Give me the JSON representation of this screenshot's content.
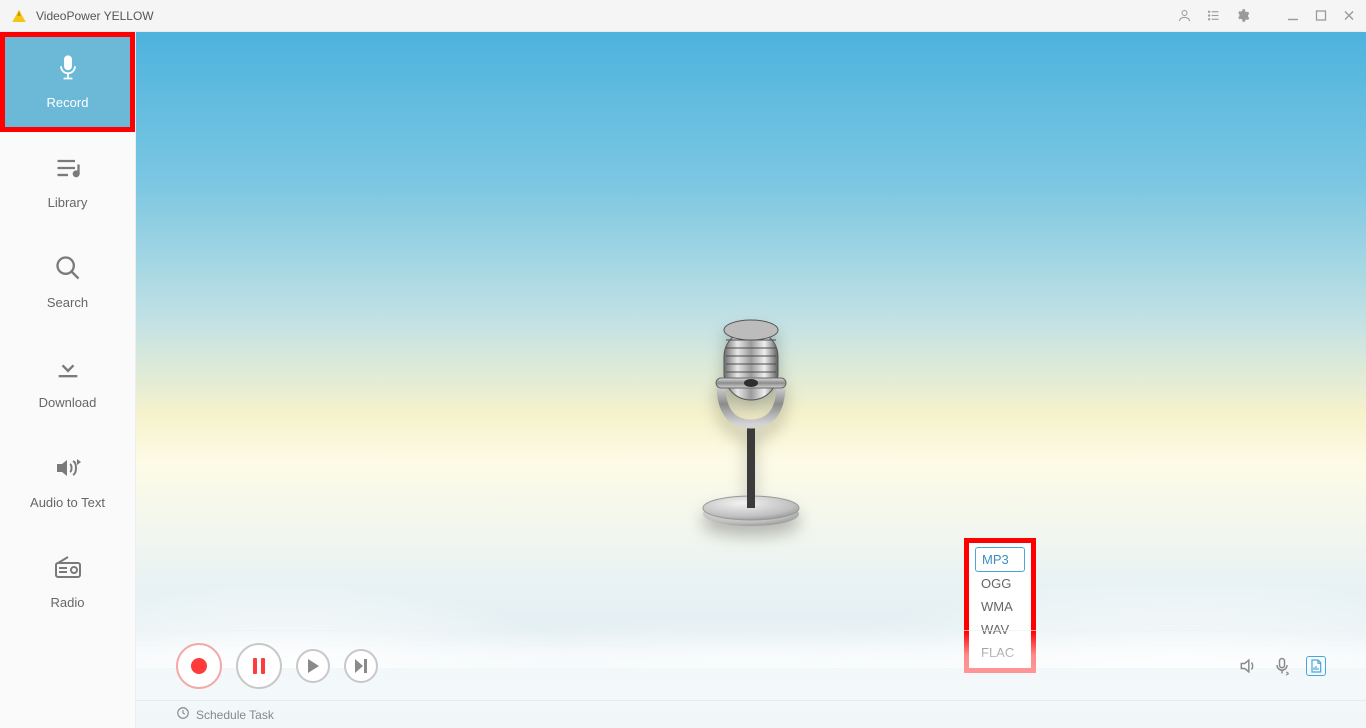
{
  "app": {
    "title": "VideoPower YELLOW"
  },
  "sidebar": {
    "items": [
      {
        "label": "Record",
        "active": true
      },
      {
        "label": "Library",
        "active": false
      },
      {
        "label": "Search",
        "active": false
      },
      {
        "label": "Download",
        "active": false
      },
      {
        "label": "Audio to Text",
        "active": false
      },
      {
        "label": "Radio",
        "active": false
      }
    ]
  },
  "format_menu": {
    "options": [
      "MP3",
      "OGG",
      "WMA",
      "WAV",
      "FLAC"
    ],
    "selected": "MP3"
  },
  "footer": {
    "schedule_task": "Schedule Task"
  },
  "icons": {
    "account": "account-icon",
    "menu": "list-icon",
    "settings": "gear-icon",
    "minimize": "minimize-icon",
    "maximize": "maximize-icon",
    "close": "close-icon",
    "speaker": "speaker-icon",
    "mic_src": "mic-source-icon",
    "format": "format-icon",
    "clock": "clock-icon"
  }
}
